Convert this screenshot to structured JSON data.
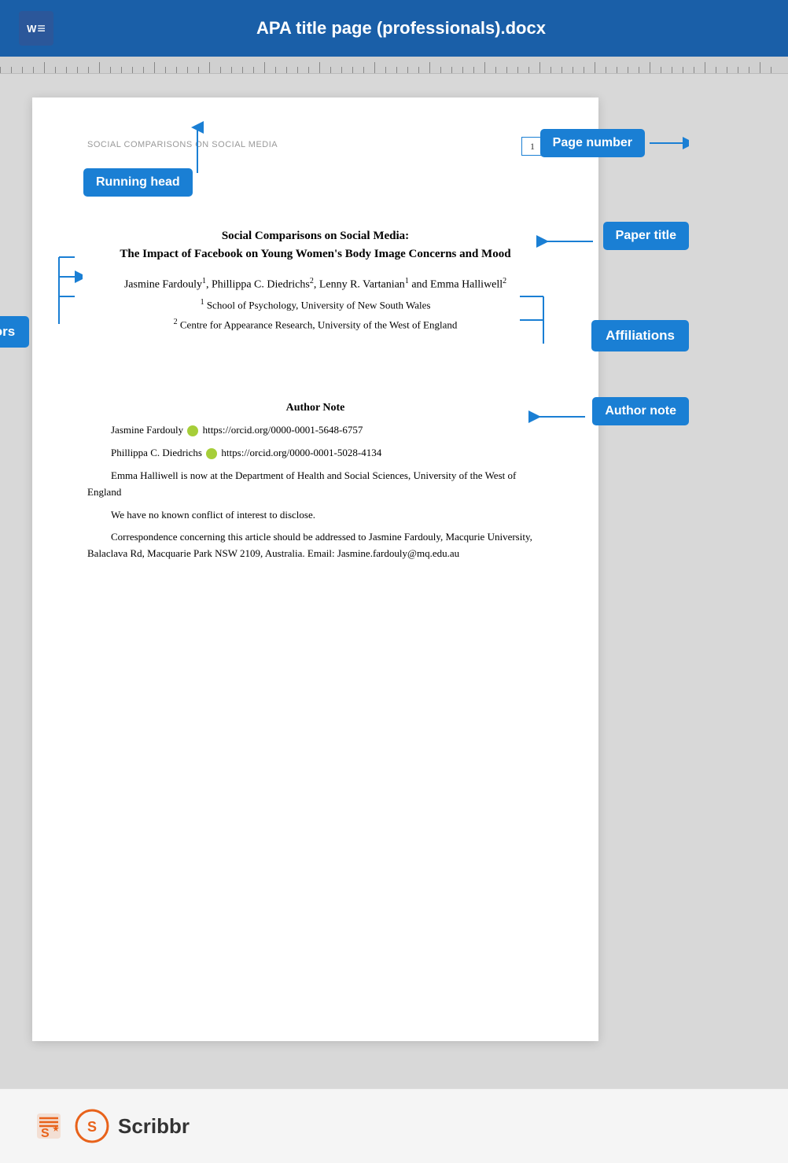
{
  "header": {
    "title": "APA title page (professionals).docx",
    "word_icon": "W"
  },
  "labels": {
    "running_head": "Running head",
    "page_number": "Page number",
    "paper_title": "Paper title",
    "authors": "Authors",
    "affiliations": "Affiliations",
    "author_note": "Author note"
  },
  "document": {
    "running_head_text": "SOCIAL COMPARISONS ON SOCIAL MEDIA",
    "page_num": "1",
    "paper_title_main": "Social Comparisons on Social Media:",
    "paper_title_sub": "The Impact of Facebook on Young Women's Body Image Concerns and Mood",
    "authors": "Jasmine Fardouly",
    "authors_rest": ", Phillippa C. Diedrichs",
    "authors_rest2": ", Lenny R. Vartanian",
    "authors_rest3": " and Emma Halliwell",
    "affil1": "School of Psychology, University of New South Wales",
    "affil2": "Centre for Appearance Research, University of the West of England",
    "author_note_heading": "Author Note",
    "author_note_lines": [
      "Jasmine Fardouly  https://orcid.org/0000-0001-5648-6757",
      "Phillippa C. Diedrichs  https://orcid.org/0000-0001-5028-4134",
      "Emma Halliwell is now at the Department of Health and Social Sciences, University of the West of England",
      "We have no known conflict of interest to disclose.",
      "Correspondence concerning this article should be addressed to Jasmine Fardouly, Macqurie University, Balaclava Rd, Macquarie Park NSW 2109, Australia. Email: Jasmine.fardouly@mq.edu.au"
    ]
  },
  "footer": {
    "scribbr": "Scribbr"
  }
}
